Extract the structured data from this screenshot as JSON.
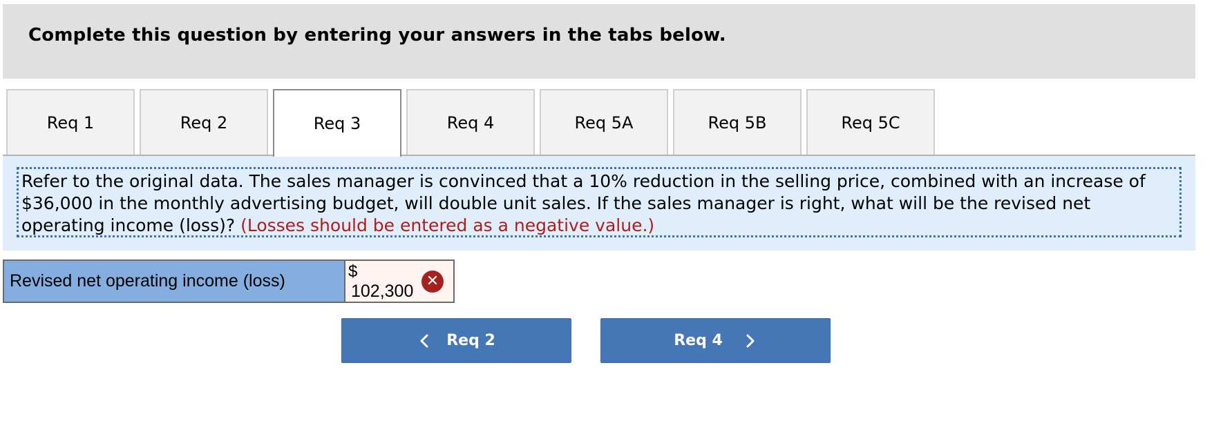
{
  "header": {
    "title": "Complete this question by entering your answers in the tabs below."
  },
  "tabs": [
    {
      "label": "Req 1",
      "active": false
    },
    {
      "label": "Req 2",
      "active": false
    },
    {
      "label": "Req 3",
      "active": true
    },
    {
      "label": "Req 4",
      "active": false
    },
    {
      "label": "Req 5A",
      "active": false
    },
    {
      "label": "Req 5B",
      "active": false
    },
    {
      "label": "Req 5C",
      "active": false
    }
  ],
  "question": {
    "text": "Refer to the original data. The sales manager is convinced that a 10% reduction in the selling price, combined with an increase of $36,000 in the monthly advertising budget, will double unit sales. If the sales manager is right, what will be the revised net operating income (loss)?",
    "note": "(Losses should be entered as a negative value.)"
  },
  "answer": {
    "label": "Revised net operating income (loss)",
    "currency": "$",
    "value": "102,300",
    "status_icon": "incorrect-x-icon"
  },
  "navigation": {
    "prev_label": "Req 2",
    "next_label": "Req 4"
  },
  "colors": {
    "header_bg": "#e0e0e0",
    "question_bg": "#dfeefa",
    "answer_label_bg": "#85aee0",
    "answer_cell_bg": "#fff3f2",
    "error_red": "#a6211d",
    "note_red": "#b01c1c",
    "button_blue": "#4577b6"
  }
}
